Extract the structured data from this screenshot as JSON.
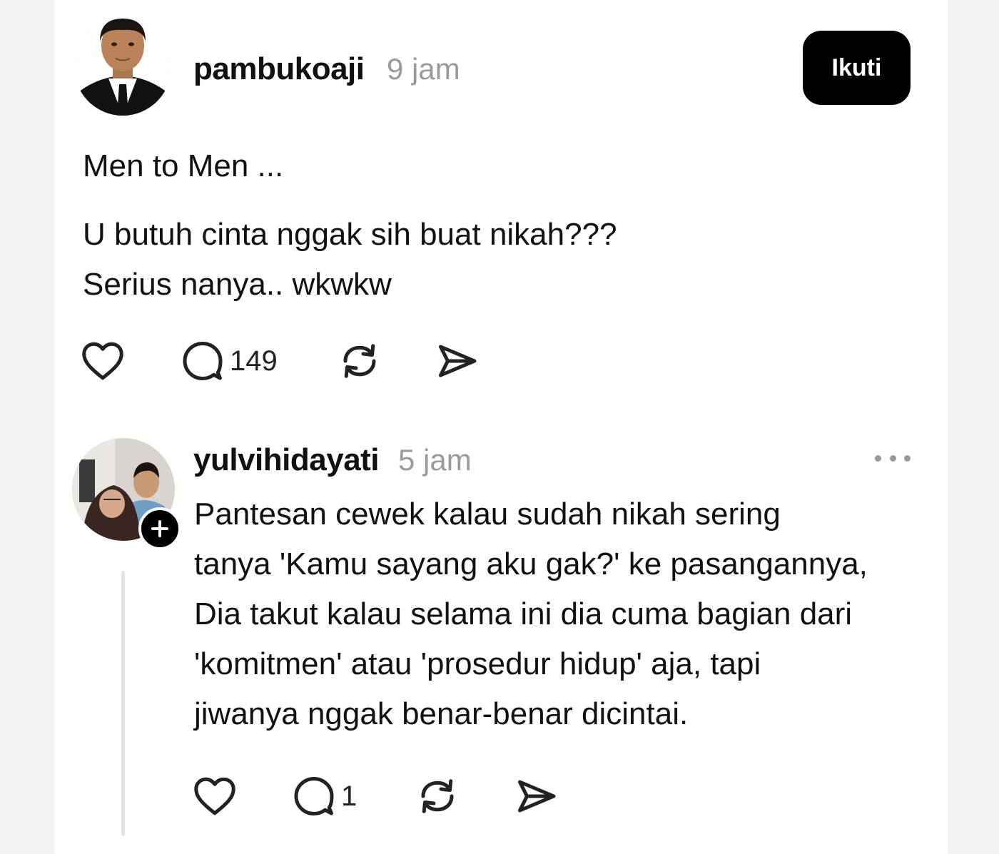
{
  "post": {
    "username": "pambukoaji",
    "time": "9 jam",
    "follow_label": "Ikuti",
    "lines": [
      "Men to Men ...",
      "U butuh cinta nggak sih buat nikah???",
      "Serius nanya.. wkwkw"
    ],
    "reply_count": "149"
  },
  "reply": {
    "username": "yulvihidayati",
    "time": "5 jam",
    "lines": [
      "Pantesan cewek kalau sudah nikah sering",
      "tanya 'Kamu sayang aku gak?' ke pasangannya,",
      "Dia takut kalau selama ini dia cuma bagian dari",
      "'komitmen' atau 'prosedur hidup' aja, tapi",
      "jiwanya nggak benar-benar dicintai."
    ],
    "reply_count": "1"
  },
  "icons": {
    "like": "heart-icon",
    "comment": "comment-bubble-icon",
    "repost": "repost-icon",
    "share": "send-icon",
    "more": "more-dots-icon",
    "follow": "plus-icon"
  },
  "colors": {
    "text": "#111111",
    "muted": "#9a9a9a",
    "button_bg": "#000000",
    "button_text": "#ffffff"
  }
}
